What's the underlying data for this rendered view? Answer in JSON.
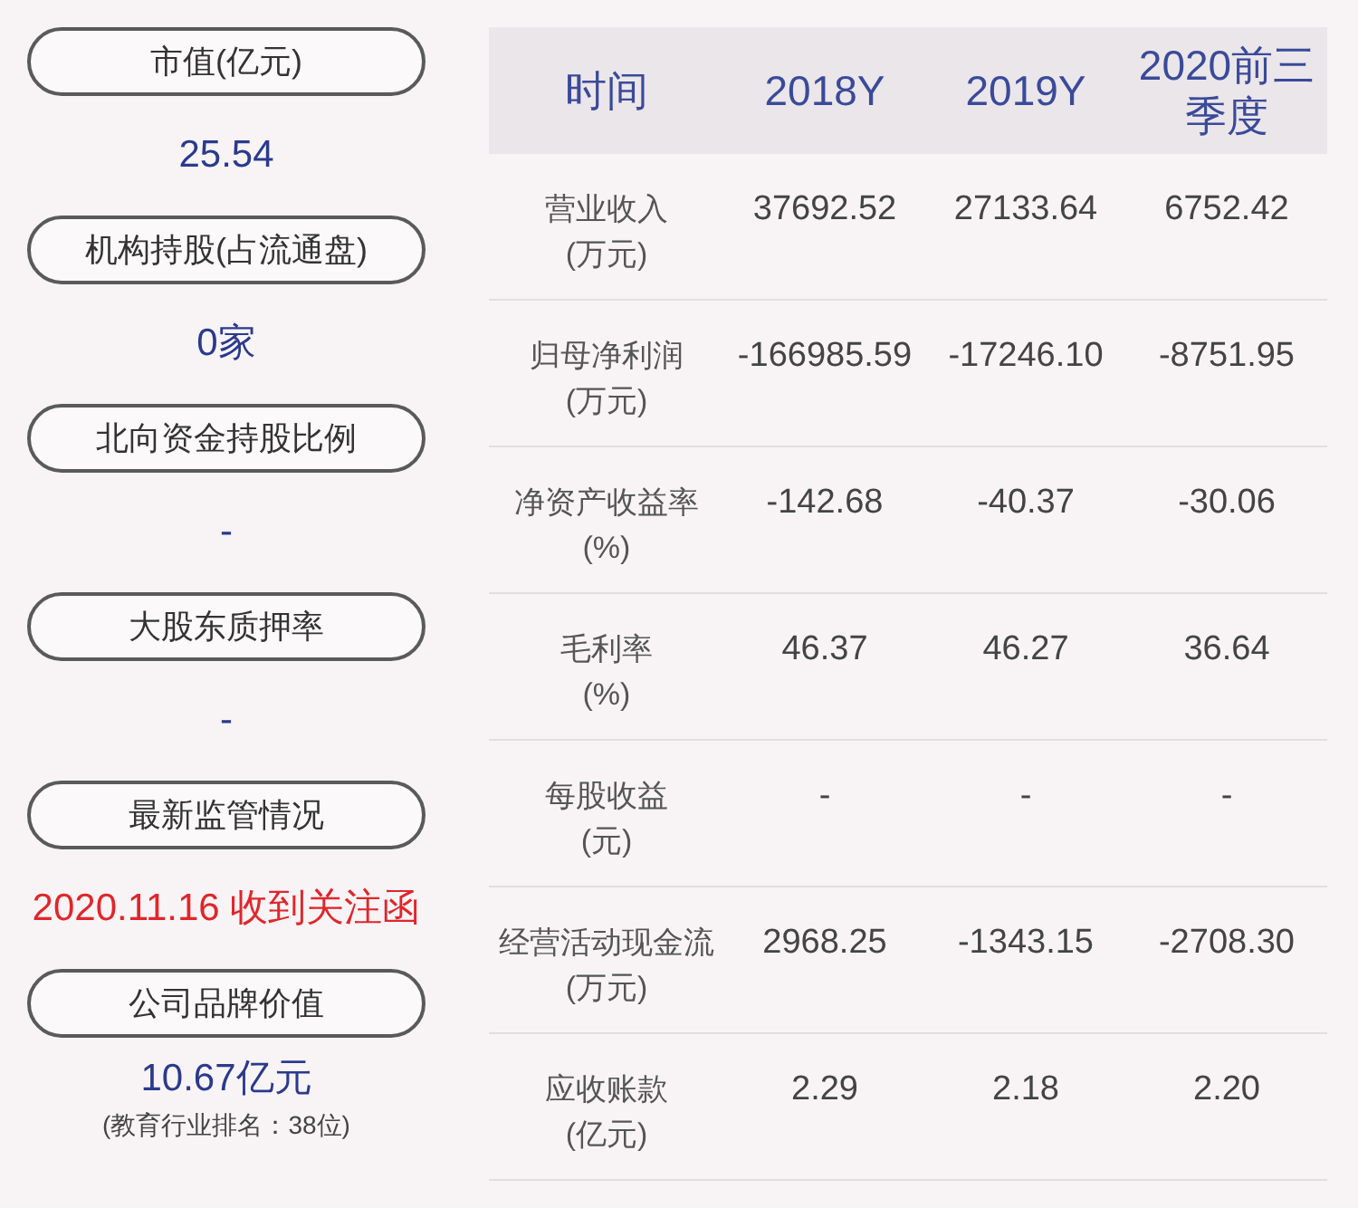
{
  "summary": [
    {
      "label": "市值(亿元)",
      "value": "25.54",
      "kind": "normal"
    },
    {
      "label": "机构持股(占流通盘)",
      "value": "0家",
      "kind": "normal"
    },
    {
      "label": "北向资金持股比例",
      "value": "-",
      "kind": "normal"
    },
    {
      "label": "大股东质押率",
      "value": "-",
      "kind": "normal"
    },
    {
      "label": "最新监管情况",
      "value": "2020.11.16 收到关注函",
      "kind": "alert"
    },
    {
      "label": "公司品牌价值",
      "value": "10.67亿元",
      "kind": "normal",
      "note": "(教育行业排名：38位)"
    }
  ],
  "table": {
    "columns": [
      "时间",
      "2018Y",
      "2019Y",
      "2020前三季度"
    ],
    "rows": [
      {
        "label": "营业收入",
        "unit": "(万元)",
        "values": [
          "37692.52",
          "27133.64",
          "6752.42"
        ]
      },
      {
        "label": "归母净利润",
        "unit": "(万元)",
        "values": [
          "-166985.59",
          "-17246.10",
          "-8751.95"
        ]
      },
      {
        "label": "净资产收益率",
        "unit": "(%)",
        "values": [
          "-142.68",
          "-40.37",
          "-30.06"
        ]
      },
      {
        "label": "毛利率",
        "unit": "(%)",
        "values": [
          "46.37",
          "46.27",
          "36.64"
        ]
      },
      {
        "label": "每股收益",
        "unit": "(元)",
        "values": [
          "-",
          "-",
          "-"
        ]
      },
      {
        "label": "经营活动现金流",
        "unit": "(万元)",
        "values": [
          "2968.25",
          "-1343.15",
          "-2708.30"
        ]
      },
      {
        "label": "应收账款",
        "unit": "(亿元)",
        "values": [
          "2.29",
          "2.18",
          "2.20"
        ]
      }
    ]
  }
}
